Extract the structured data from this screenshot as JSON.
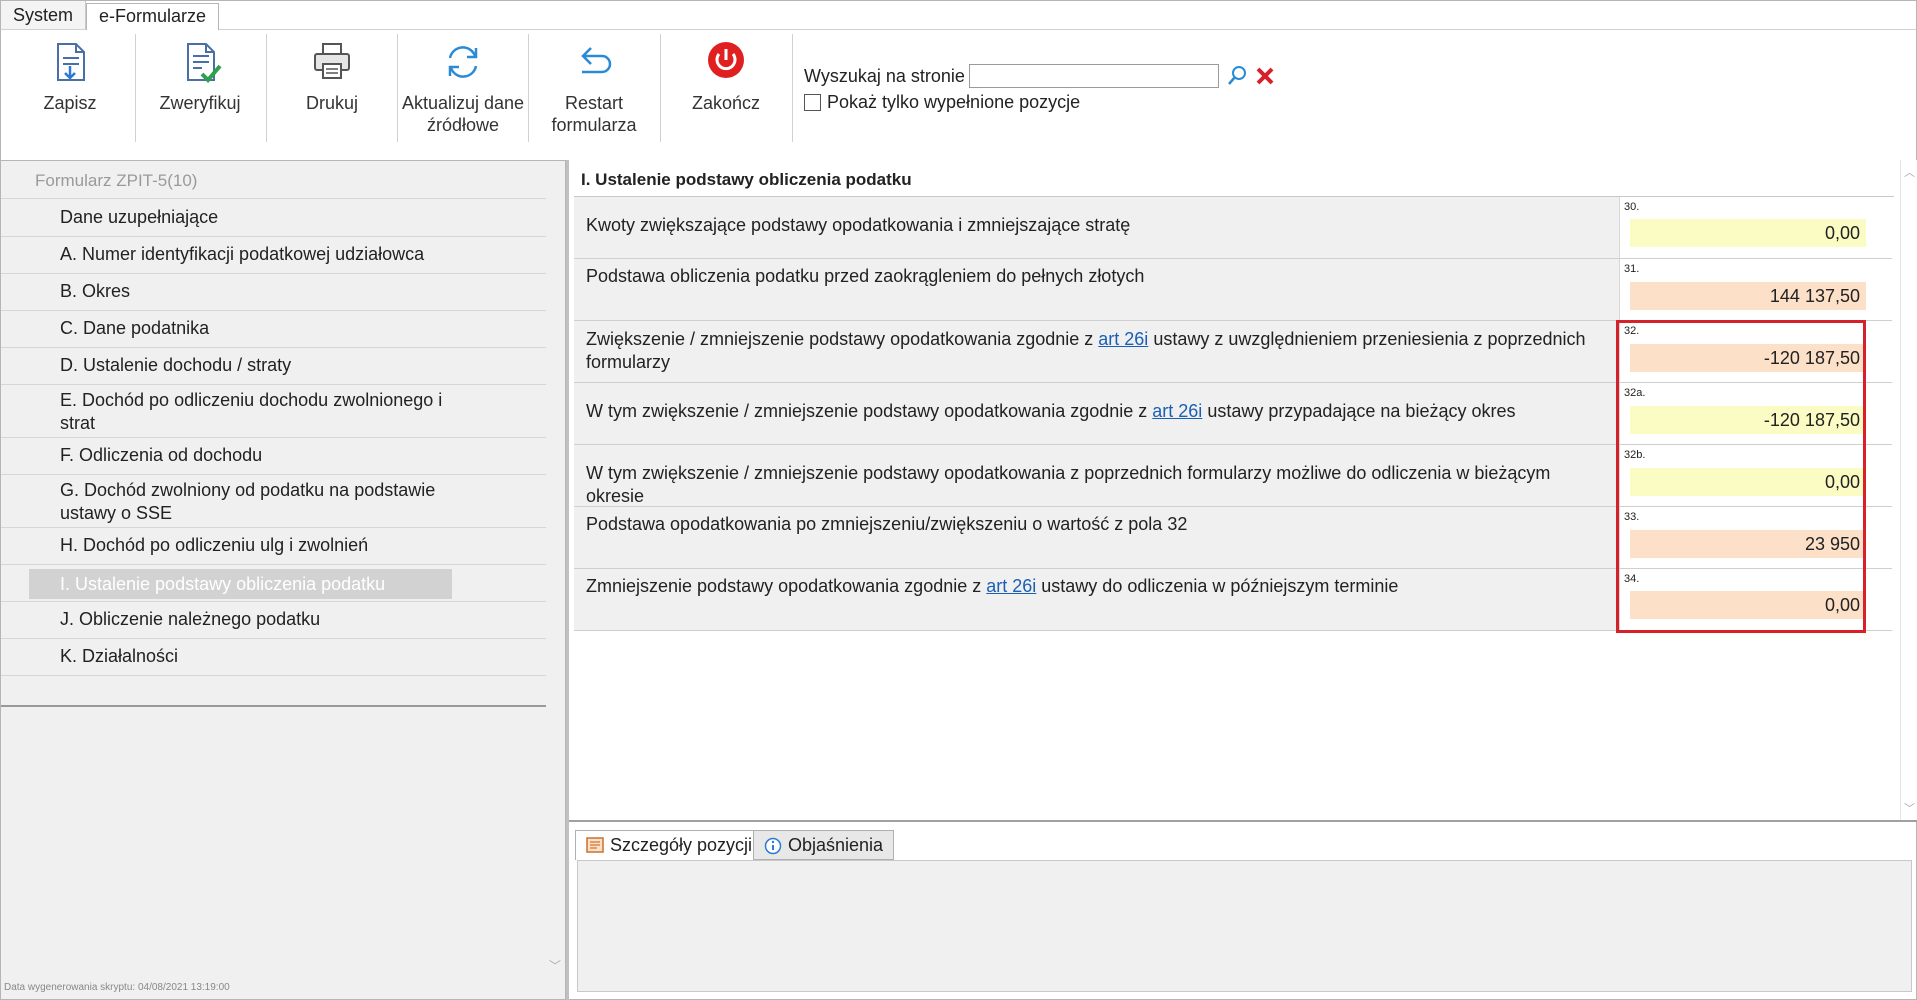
{
  "menu": {
    "items": [
      "System",
      "e-Formularze"
    ]
  },
  "toolbar": {
    "buttons": [
      {
        "label": "Zapisz",
        "icon": "save-document-icon"
      },
      {
        "label": "Zweryfikuj",
        "icon": "verify-document-icon"
      },
      {
        "label": "Drukuj",
        "icon": "printer-icon"
      },
      {
        "label1": "Aktualizuj dane",
        "label2": "źródłowe",
        "icon": "refresh-icon"
      },
      {
        "label1": "Restart",
        "label2": "formularza",
        "icon": "undo-icon"
      },
      {
        "label": "Zakończ",
        "icon": "power-icon"
      }
    ],
    "search_label": "Wyszukaj na stronie",
    "search_value": "",
    "show_filled_label": "Pokaż tylko wypełnione pozycje",
    "show_filled_checked": false
  },
  "nav": {
    "header": "Formularz ZPIT-5(10)",
    "items": [
      {
        "l1": "Dane uzupełniające"
      },
      {
        "l1": "A. Numer identyfikacji podatkowej udziałowca"
      },
      {
        "l1": "B. Okres"
      },
      {
        "l1": "C. Dane podatnika"
      },
      {
        "l1": "D. Ustalenie dochodu / straty"
      },
      {
        "l1": "E. Dochód po odliczeniu dochodu zwolnionego i",
        "l2": "strat"
      },
      {
        "l1": "F.  Odliczenia od dochodu"
      },
      {
        "l1": "G. Dochód zwolniony od podatku na podstawie",
        "l2": "ustawy o SSE"
      },
      {
        "l1": "H. Dochód po odliczeniu ulg i zwolnień"
      },
      {
        "l1": "I. Ustalenie podstawy obliczenia podatku",
        "selected": true
      },
      {
        "l1": "J. Obliczenie należnego podatku"
      },
      {
        "l1": "K. Działalności"
      }
    ],
    "generated": "Data wygenerowania skryptu: 04/08/2021 13:19:00"
  },
  "section": {
    "title": "I. Ustalenie podstawy obliczenia podatku",
    "rows": [
      {
        "num": "30.",
        "pre": "Kwoty zwiększające podstawy opodatkowania i zmniejszające stratę",
        "link": "",
        "post": "",
        "value": "0,00",
        "color": "yellow"
      },
      {
        "num": "31.",
        "pre": " Podstawa obliczenia podatku przed zaokrągleniem do pełnych złotych",
        "link": "",
        "post": "",
        "value": "144 137,50",
        "color": "orange"
      },
      {
        "num": "32.",
        "pre": "Zwiększenie / zmniejszenie podstawy opodatkowania zgodnie z ",
        "link": "art 26i",
        "post": " ustawy z uwzględnieniem przeniesienia z poprzednich formularzy",
        "value": "-120 187,50",
        "color": "orange"
      },
      {
        "num": "32a.",
        "pre": "W tym zwiększenie / zmniejszenie podstawy opodatkowania zgodnie z ",
        "link": "art 26i",
        "post": " ustawy przypadające na bieżący okres",
        "value": "-120 187,50",
        "color": "yellow"
      },
      {
        "num": "32b.",
        "pre": "W tym zwiększenie / zmniejszenie podstawy opodatkowania z poprzednich formularzy możliwe do odliczenia w bieżącym okresie",
        "link": "",
        "post": "",
        "value": "0,00",
        "color": "yellow"
      },
      {
        "num": "33.",
        "pre": "Podstawa opodatkowania po zmniejszeniu/zwiększeniu o wartość z pola 32",
        "link": "",
        "post": "",
        "value": "23 950",
        "color": "orange"
      },
      {
        "num": "34.",
        "pre": "Zmniejszenie podstawy opodatkowania zgodnie z ",
        "link": "art 26i",
        "post": " ustawy do odliczenia w późniejszym terminie",
        "value": "0,00",
        "color": "orange"
      }
    ]
  },
  "details": {
    "tabs": [
      {
        "label": "Szczegóły pozycji",
        "icon": "details-icon",
        "active": true
      },
      {
        "label": "Objaśnienia",
        "icon": "info-icon",
        "active": false
      }
    ]
  },
  "colors": {
    "highlight": "#d6202a",
    "yellow": "#fbfbc4",
    "orange": "#fde0c8",
    "link": "#1a5fb4"
  }
}
